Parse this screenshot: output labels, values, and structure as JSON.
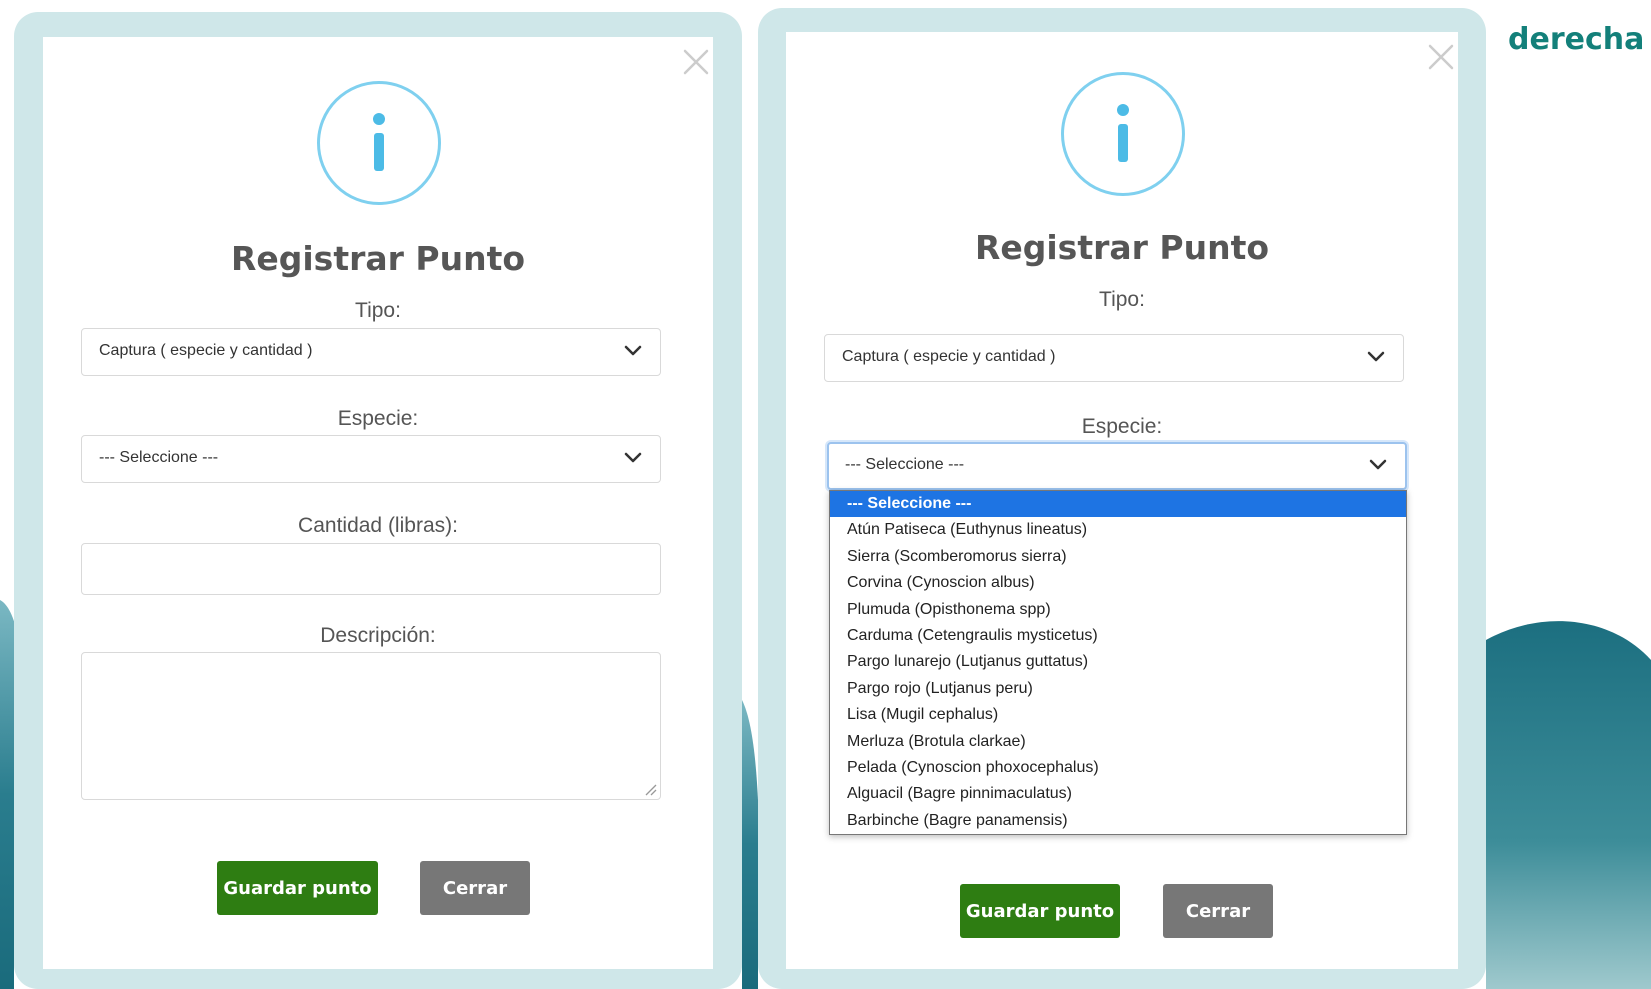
{
  "corner_heading": "derecha",
  "close_glyph": "×",
  "colors": {
    "frame": "#cfe7e9",
    "info": "#4cbbe6",
    "save": "#2e7d12",
    "cerrar": "#777777",
    "accent_text": "#13807a",
    "selected_option": "#1e74e3"
  },
  "left_modal": {
    "title": "Registrar Punto",
    "tipo_label": "Tipo:",
    "tipo_value": "Captura ( especie y cantidad )",
    "especie_label": "Especie:",
    "especie_value": "--- Seleccione ---",
    "cantidad_label": "Cantidad (libras):",
    "cantidad_value": "",
    "descripcion_label": "Descripción:",
    "descripcion_value": "",
    "save_label": "Guardar punto",
    "close_label": "Cerrar"
  },
  "right_modal": {
    "title": "Registrar Punto",
    "tipo_label": "Tipo:",
    "tipo_value": "Captura ( especie y cantidad )",
    "especie_label": "Especie:",
    "especie_value": "--- Seleccione ---",
    "save_label": "Guardar punto",
    "close_label": "Cerrar",
    "especie_options": [
      "--- Seleccione ---",
      "Atún Patiseca (Euthynus lineatus)",
      "Sierra (Scomberomorus sierra)",
      "Corvina (Cynoscion albus)",
      "Plumuda (Opisthonema spp)",
      "Carduma (Cetengraulis mysticetus)",
      "Pargo lunarejo (Lutjanus guttatus)",
      "Pargo rojo (Lutjanus peru)",
      "Lisa (Mugil cephalus)",
      "Merluza (Brotula clarkae)",
      "Pelada (Cynoscion phoxocephalus)",
      "Alguacil (Bagre pinnimaculatus)",
      "Barbinche (Bagre panamensis)"
    ],
    "selected_option_index": 0
  }
}
